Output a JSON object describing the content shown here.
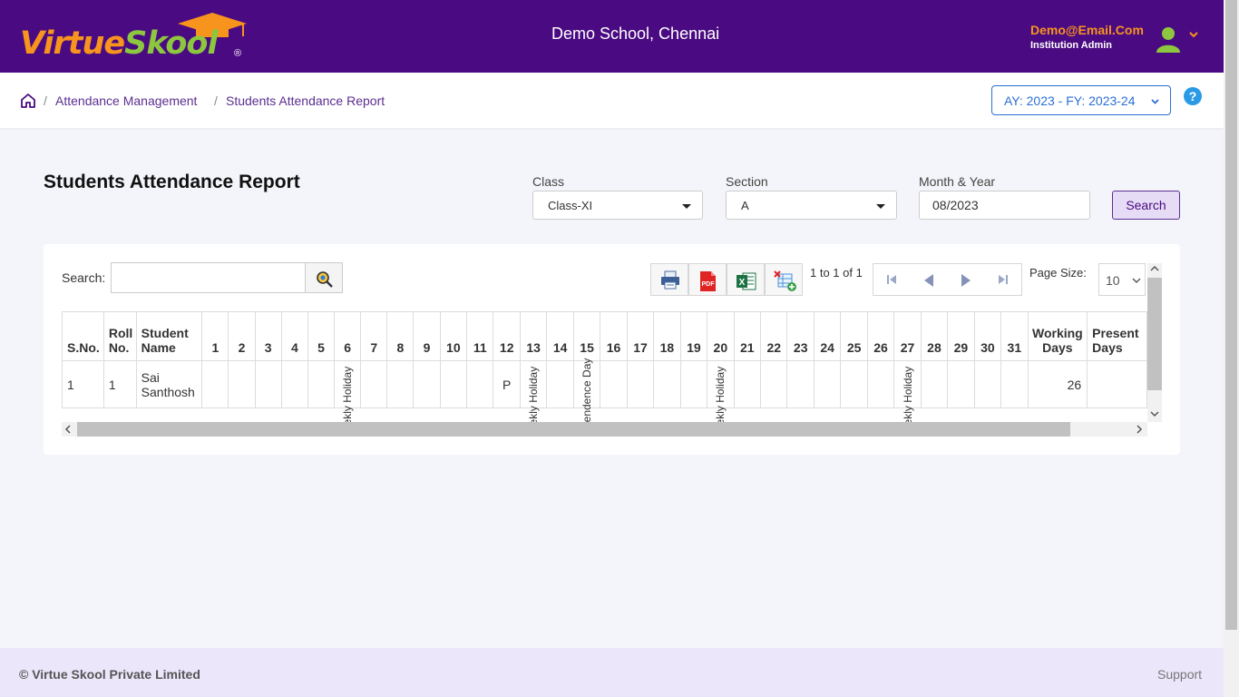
{
  "header": {
    "logo": {
      "part1": "Virtue",
      "part2": "Skool",
      "reg": "®"
    },
    "school_name": "Demo School, Chennai",
    "user_email": "Demo@Email.Com",
    "user_role": "Institution Admin"
  },
  "breadcrumb": {
    "items": [
      "Attendance Management",
      "Students Attendance Report"
    ],
    "separator": "/"
  },
  "academic_year": "AY: 2023 - FY: 2023-24",
  "help_label": "?",
  "page_title": "Students Attendance Report",
  "filters": {
    "class_label": "Class",
    "class_value": "Class-XI",
    "section_label": "Section",
    "section_value": "A",
    "month_label": "Month & Year",
    "month_value": "08/2023",
    "search_label": "Search"
  },
  "grid": {
    "search_label": "Search:",
    "search_value": "",
    "pager_info": "1 to 1 of 1",
    "page_size_label": "Page Size:",
    "page_size_value": "10",
    "columns": {
      "sno": "S.No.",
      "roll": "Roll No.",
      "name": "Student Name",
      "days": [
        "1",
        "2",
        "3",
        "4",
        "5",
        "6",
        "7",
        "8",
        "9",
        "10",
        "11",
        "12",
        "13",
        "14",
        "15",
        "16",
        "17",
        "18",
        "19",
        "20",
        "21",
        "22",
        "23",
        "24",
        "25",
        "26",
        "27",
        "28",
        "29",
        "30",
        "31"
      ],
      "working_days": "Working Days",
      "present_days": "Present Days"
    },
    "holiday_texts": {
      "weekly": "Weekly Holiday",
      "independence": "Independence Day"
    },
    "rows": [
      {
        "sno": "1",
        "roll": "1",
        "name": "Sai Santhosh",
        "day12": "P",
        "working_days": "26",
        "present_days": ""
      }
    ]
  },
  "footer": {
    "copyright": "© Virtue Skool Private Limited",
    "support": "Support"
  },
  "colors": {
    "header_bg": "#4a0a82",
    "accent_orange": "#f7941d",
    "accent_green": "#8dc63f",
    "link_purple": "#5b2e91",
    "ay_blue": "#2a6fd6",
    "footer_bg": "#ebe6fa"
  },
  "icons": [
    "graduation-cap-icon",
    "avatar-icon",
    "chevron-down-icon",
    "home-icon",
    "help-icon",
    "magnifier-icon",
    "print-icon",
    "pdf-icon",
    "excel-icon",
    "export-icon",
    "first-page-icon",
    "prev-page-icon",
    "next-page-icon",
    "last-page-icon"
  ]
}
